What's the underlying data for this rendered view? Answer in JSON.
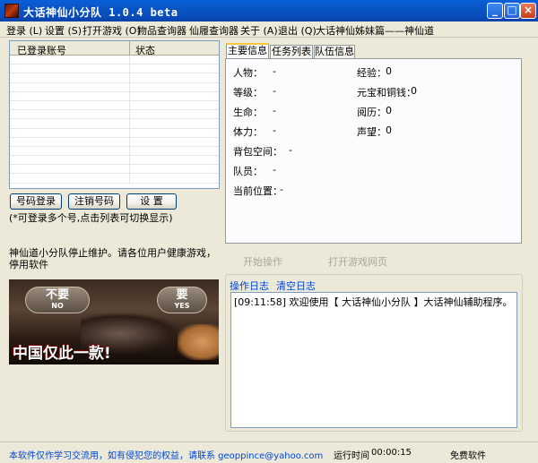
{
  "window": {
    "title": "大话神仙小分队 1.0.4 beta"
  },
  "menu": [
    "登录 (L)",
    "设置 (S)",
    "打开游戏 (O)",
    "物品查询器",
    "仙履查询器",
    "关于 (A)",
    "退出 (Q)",
    "大话神仙姊妹篇——神仙道"
  ],
  "account_table": {
    "columns": [
      "已登录账号",
      "状态"
    ],
    "rows": []
  },
  "buttons": {
    "login": "号码登录",
    "logout": "注销号码",
    "settings": "设 置"
  },
  "hint": "(*可登录多个号,点击列表可切换显示)",
  "notice": "神仙道小分队停止维护。请各位用户健康游戏，停用软件",
  "ad": {
    "no_label": "不要",
    "no_sub": "NO",
    "yes_label": "要",
    "yes_sub": "YES",
    "slogan": "中国仅此一款!"
  },
  "tabs": [
    "主要信息",
    "任务列表",
    "队伍信息"
  ],
  "info": {
    "character": {
      "label": "人物：",
      "value": "-"
    },
    "level": {
      "label": "等级：",
      "value": "-"
    },
    "hp": {
      "label": "生命：",
      "value": "-"
    },
    "stamina": {
      "label": "体力：",
      "value": "-"
    },
    "bag": {
      "label": "背包空间：",
      "value": "-"
    },
    "team": {
      "label": "队员：",
      "value": "-"
    },
    "position": {
      "label": "当前位置：",
      "value": "-"
    },
    "exp": {
      "label": "经验：",
      "value": "0"
    },
    "money": {
      "label": "元宝和铜钱：",
      "value": "0"
    },
    "experience": {
      "label": "阅历：",
      "value": "0"
    },
    "fame": {
      "label": "声望：",
      "value": "0"
    }
  },
  "ops": {
    "start": "开始操作",
    "open_web": "打开游戏网页"
  },
  "log": {
    "title": "操作日志",
    "clear": "清空日志",
    "entries": [
      "[09:11:58] 欢迎使用【 大话神仙小分队 】大话神仙辅助程序。"
    ]
  },
  "status": {
    "disclaimer": "本软件仅作学习交流用，如有侵犯您的权益，请联系 geoppince@yahoo.com",
    "runtime_label": "运行时间",
    "runtime": "00:00:15",
    "free": "免费软件"
  },
  "colors": {
    "titlebar": "#0A54C4",
    "link": "#0046D5",
    "disabled": "#ACA899",
    "background": "#ECE9D8"
  }
}
